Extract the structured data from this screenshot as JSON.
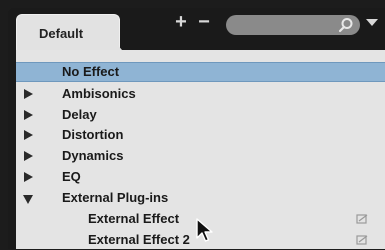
{
  "tab": {
    "label": "Default"
  },
  "toolbar": {
    "add_label": "+",
    "remove_label": "−"
  },
  "search": {
    "placeholder": ""
  },
  "list": {
    "items": [
      {
        "label": "No Effect",
        "selected": true,
        "expander": "none"
      },
      {
        "label": "Ambisonics",
        "expander": "collapsed"
      },
      {
        "label": "Delay",
        "expander": "collapsed"
      },
      {
        "label": "Distortion",
        "expander": "collapsed"
      },
      {
        "label": "Dynamics",
        "expander": "collapsed"
      },
      {
        "label": "EQ",
        "expander": "collapsed"
      },
      {
        "label": "External Plug-ins",
        "expander": "expanded"
      },
      {
        "label": "External Effect",
        "expander": "none",
        "icon": "external-plugin-icon"
      },
      {
        "label": "External Effect 2",
        "expander": "none",
        "icon": "external-plugin-icon"
      }
    ]
  },
  "colors": {
    "selection": "#8fb4d4",
    "list_background": "#e4e4e4",
    "chrome": "#1a1a1a"
  }
}
